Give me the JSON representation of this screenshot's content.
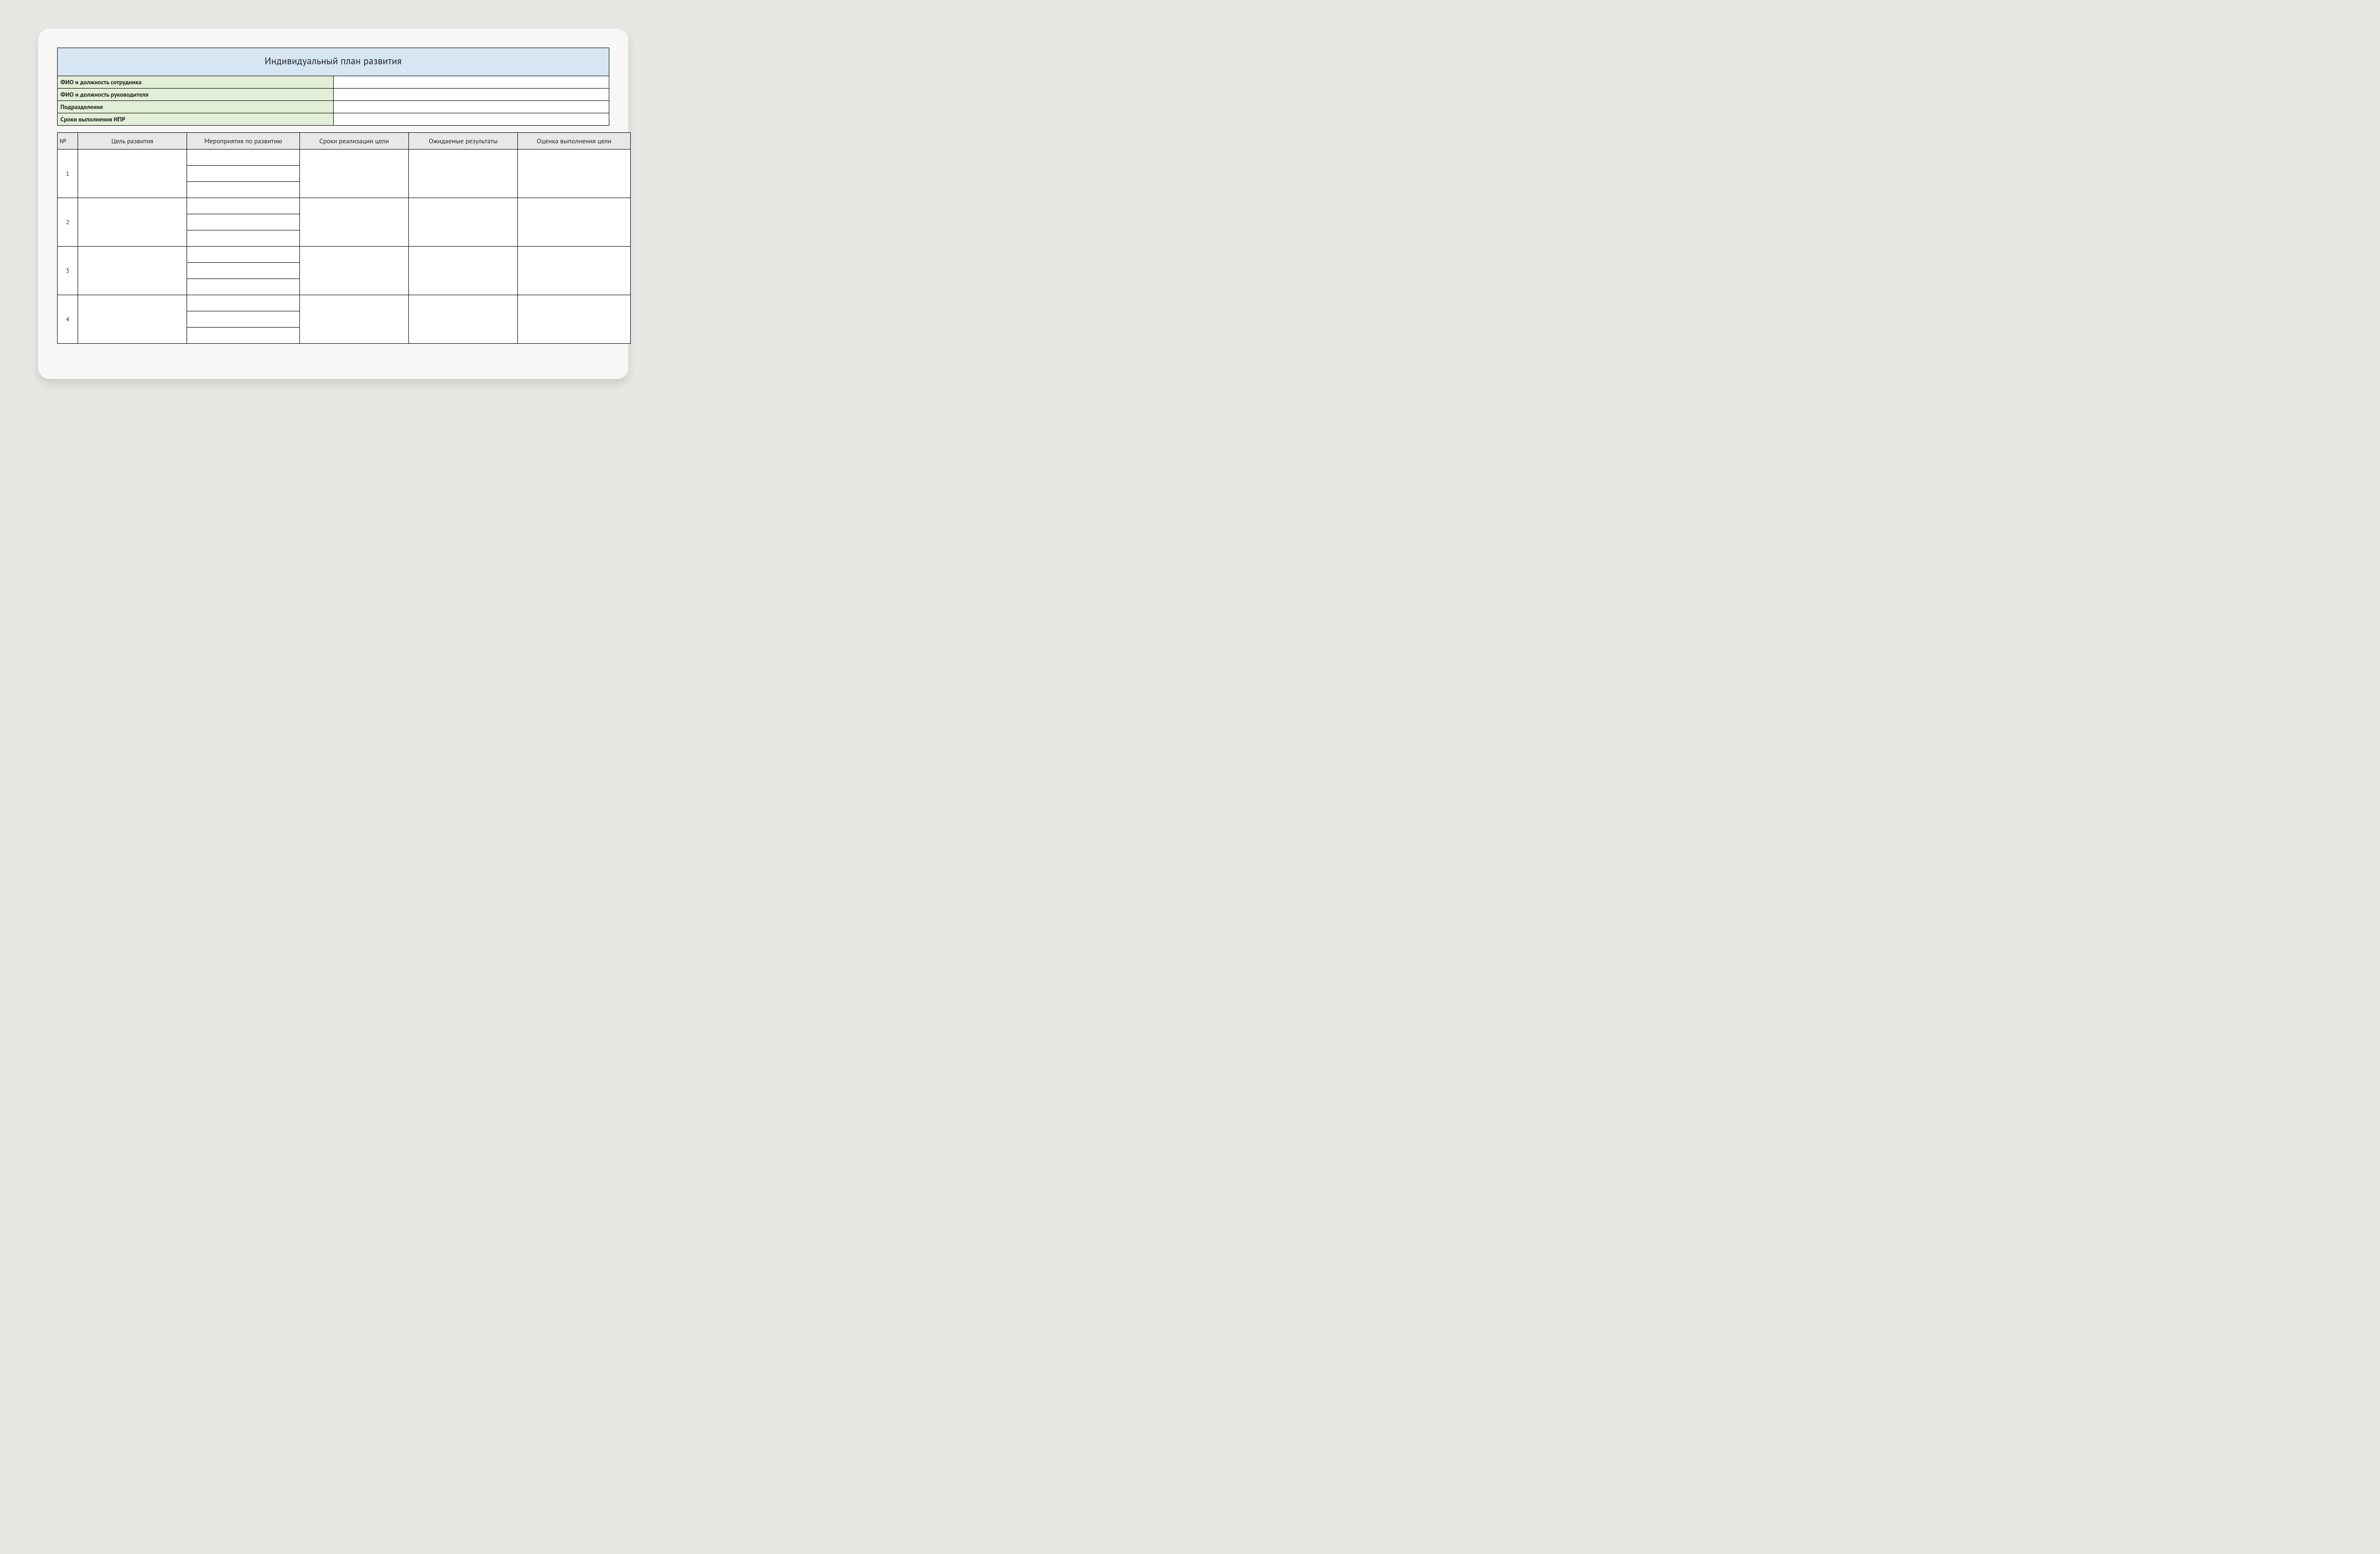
{
  "title": "Индивидуальный план развития",
  "header_rows": [
    {
      "label": "ФИО и должность сотрудника",
      "value": ""
    },
    {
      "label": "ФИО и должность руководителя",
      "value": ""
    },
    {
      "label": "Подразделение",
      "value": ""
    },
    {
      "label": "Сроки выполнения ИПР",
      "value": ""
    }
  ],
  "columns": {
    "number": "№",
    "goal": "Цель развития",
    "activities": "Мероприятия по развитию",
    "timeline": "Сроки реализации цели",
    "results": "Ожидаемые результаты",
    "evaluation": "Оценка выполнения цели"
  },
  "rows": [
    {
      "number": "1",
      "goal": "",
      "activities": [
        "",
        "",
        ""
      ],
      "timeline": "",
      "results": "",
      "evaluation": ""
    },
    {
      "number": "2",
      "goal": "",
      "activities": [
        "",
        "",
        ""
      ],
      "timeline": "",
      "results": "",
      "evaluation": ""
    },
    {
      "number": "3",
      "goal": "",
      "activities": [
        "",
        "",
        ""
      ],
      "timeline": "",
      "results": "",
      "evaluation": ""
    },
    {
      "number": "4",
      "goal": "",
      "activities": [
        "",
        "",
        ""
      ],
      "timeline": "",
      "results": "",
      "evaluation": ""
    }
  ]
}
